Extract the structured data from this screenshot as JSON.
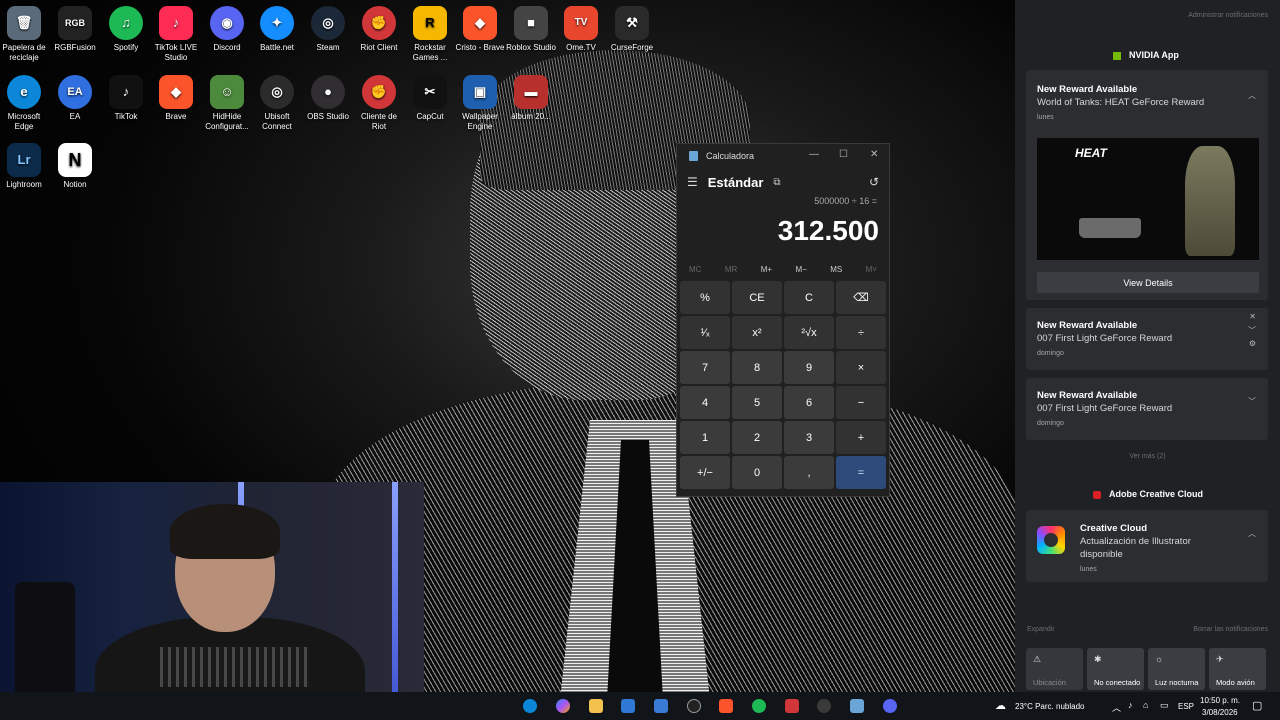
{
  "desktop": {
    "icons": [
      {
        "label": "Papelera de reciclaje",
        "glyph": "🗑",
        "color": "#5a6a7a"
      },
      {
        "label": "RGBFusion",
        "glyph": "RGB",
        "color": "#222222"
      },
      {
        "label": "Spotify",
        "glyph": "♫",
        "color": "#1db954"
      },
      {
        "label": "TikTok LIVE Studio",
        "glyph": "♪",
        "color": "#fe2c55"
      },
      {
        "label": "Discord",
        "glyph": "◉",
        "color": "#5865f2"
      },
      {
        "label": "Battle.net",
        "glyph": "✦",
        "color": "#148eff"
      },
      {
        "label": "Steam",
        "glyph": "◎",
        "color": "#1b2838"
      },
      {
        "label": "Riot Client",
        "glyph": "✊",
        "color": "#d13639"
      },
      {
        "label": "Rockstar Games ...",
        "glyph": "R",
        "color": "#f5b700"
      },
      {
        "label": "Cristo - Brave",
        "glyph": "◆",
        "color": "#fb542b"
      },
      {
        "label": "Roblox Studio",
        "glyph": "■",
        "color": "#444444"
      },
      {
        "label": "Ome.TV",
        "glyph": "TV",
        "color": "#e8472e"
      },
      {
        "label": "CurseForge",
        "glyph": "⚒",
        "color": "#2a2a2a"
      },
      {
        "label": "Microsoft Edge",
        "glyph": "e",
        "color": "#0c86d8"
      },
      {
        "label": "EA",
        "glyph": "EA",
        "color": "#2f6fe0"
      },
      {
        "label": "TikTok",
        "glyph": "♪",
        "color": "#111111"
      },
      {
        "label": "Brave",
        "glyph": "◆",
        "color": "#fb542b"
      },
      {
        "label": "HidHide Configurat...",
        "glyph": "☺",
        "color": "#4c8a3c"
      },
      {
        "label": "Ubisoft Connect",
        "glyph": "◎",
        "color": "#2b2b2b"
      },
      {
        "label": "OBS Studio",
        "glyph": "●",
        "color": "#302e31"
      },
      {
        "label": "Cliente de Riot",
        "glyph": "✊",
        "color": "#d13639"
      },
      {
        "label": "CapCut",
        "glyph": "✂",
        "color": "#111111"
      },
      {
        "label": "Wallpaper Engine",
        "glyph": "▣",
        "color": "#1f5fb0"
      },
      {
        "label": "álbum 20...",
        "glyph": "▬",
        "color": "#b8302e"
      },
      {
        "label": "Lightroom",
        "glyph": "Lr",
        "color": "#0c2a4a"
      },
      {
        "label": "Notion",
        "glyph": "N",
        "color": "#ffffff"
      }
    ]
  },
  "calculator": {
    "window_title": "Calculadora",
    "mode": "Estándar",
    "expression": "5000000 ÷ 16 =",
    "result": "312.500",
    "memory": [
      "MC",
      "MR",
      "M+",
      "M−",
      "MS",
      "M˅"
    ],
    "keys": [
      "%",
      "CE",
      "C",
      "⌫",
      "¹⁄ₓ",
      "x²",
      "²√x",
      "÷",
      "7",
      "8",
      "9",
      "×",
      "4",
      "5",
      "6",
      "−",
      "1",
      "2",
      "3",
      "+",
      "+/−",
      "0",
      ",",
      "="
    ]
  },
  "notifications": {
    "manage_label": "Administrar notificaciones",
    "nvidia": {
      "group": "NVIDIA App",
      "card1": {
        "title": "New Reward Available",
        "body": "World of Tanks: HEAT GeForce Reward",
        "time": "lunes",
        "brand": "HEAT",
        "button": "View Details"
      },
      "card2": {
        "title": "New Reward Available",
        "body": "007 First Light GeForce Reward",
        "time": "domingo"
      },
      "card3": {
        "title": "New Reward Available",
        "body": "007 First Light GeForce Reward",
        "time": "domingo"
      },
      "more": "Ver más (2)"
    },
    "adobe": {
      "group": "Adobe Creative Cloud",
      "card": {
        "title": "Creative Cloud",
        "body1": "Actualización de Illustrator",
        "body2": "disponible",
        "time": "lunes"
      }
    },
    "expand": "Expandir",
    "clear": "Borrar las notificaciones",
    "quick_actions": [
      {
        "label": "Ubicación",
        "glyph": "⚠"
      },
      {
        "label": "No conectado",
        "glyph": "✱"
      },
      {
        "label": "Luz nocturna",
        "glyph": "☼"
      },
      {
        "label": "Modo avión",
        "glyph": "✈"
      }
    ]
  },
  "taskbar": {
    "weather": "23°C  Parc. nublado",
    "lang": "ESP",
    "time": "10:50 p. m.",
    "date": "3/08/2026"
  }
}
